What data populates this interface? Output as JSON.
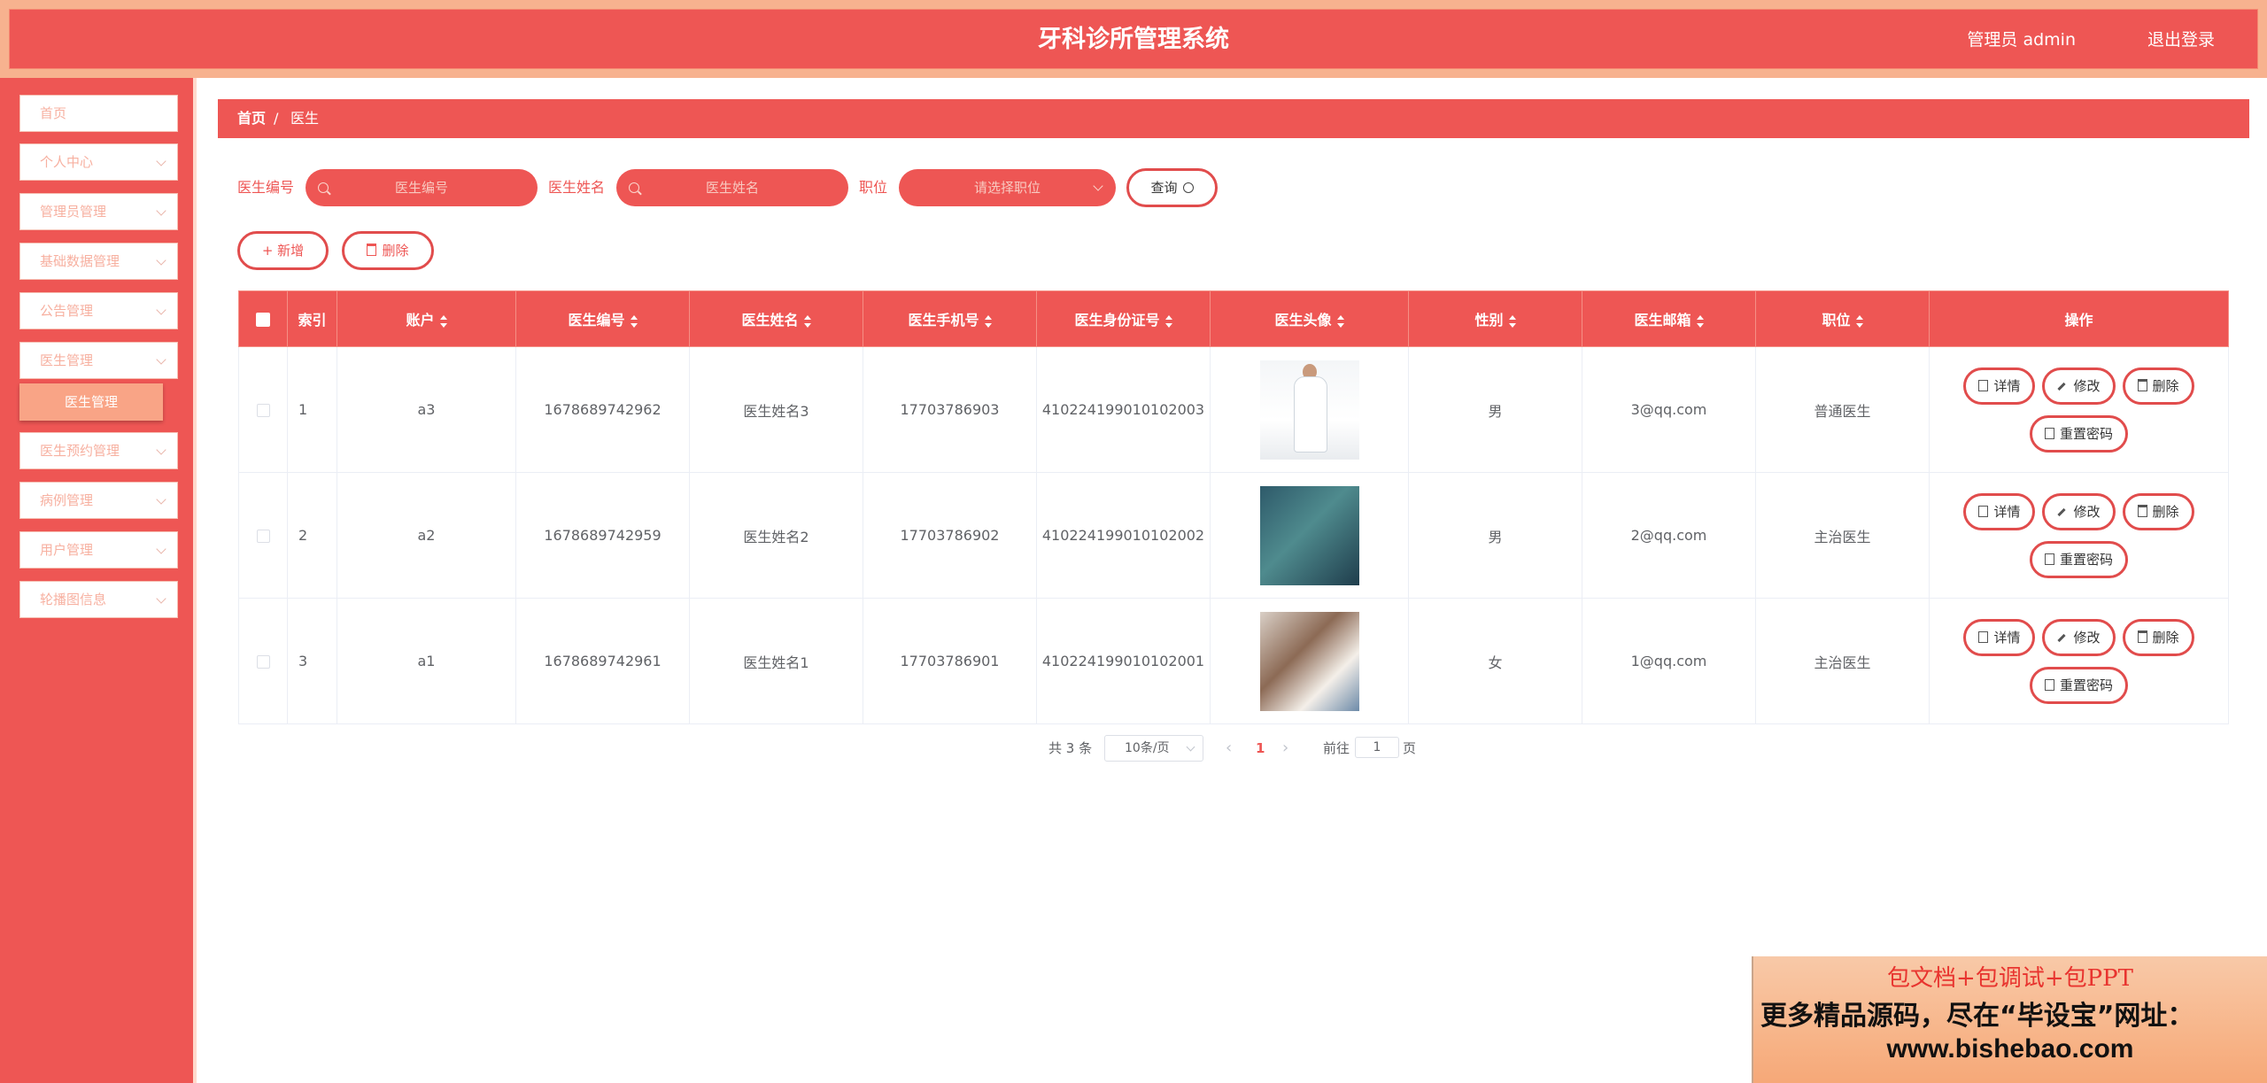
{
  "header": {
    "title": "牙科诊所管理系统",
    "user": "管理员 admin",
    "logout": "退出登录"
  },
  "sidebar": {
    "items": [
      {
        "label": "首页"
      },
      {
        "label": "个人中心"
      },
      {
        "label": "管理员管理"
      },
      {
        "label": "基础数据管理"
      },
      {
        "label": "公告管理"
      },
      {
        "label": "医生管理"
      },
      {
        "label": "医生预约管理"
      },
      {
        "label": "病例管理"
      },
      {
        "label": "用户管理"
      },
      {
        "label": "轮播图信息"
      }
    ],
    "active_sub": "医生管理"
  },
  "breadcrumb": {
    "home": "首页",
    "sep": "/",
    "current": "医生"
  },
  "search": {
    "code_label": "医生编号",
    "code_placeholder": "医生编号",
    "name_label": "医生姓名",
    "name_placeholder": "医生姓名",
    "position_label": "职位",
    "position_placeholder": "请选择职位",
    "query": "查询"
  },
  "actions": {
    "add": "+ 新增",
    "delete": "删除"
  },
  "table": {
    "headers": [
      "索引",
      "账户",
      "医生编号",
      "医生姓名",
      "医生手机号",
      "医生身份证号",
      "医生头像",
      "性别",
      "医生邮箱",
      "职位",
      "操作"
    ],
    "rows": [
      {
        "index": "1",
        "account": "a3",
        "code": "1678689742962",
        "name": "医生姓名3",
        "phone": "17703786903",
        "idcard": "410224199010102003",
        "avatar": "doctor-in-white-coat",
        "gender": "男",
        "email": "3@qq.com",
        "position": "普通医生"
      },
      {
        "index": "2",
        "account": "a2",
        "code": "1678689742959",
        "name": "医生姓名2",
        "phone": "17703786902",
        "idcard": "410224199010102002",
        "avatar": "surgical-team",
        "gender": "男",
        "email": "2@qq.com",
        "position": "主治医生"
      },
      {
        "index": "3",
        "account": "a1",
        "code": "1678689742961",
        "name": "医生姓名1",
        "phone": "17703786901",
        "idcard": "410224199010102001",
        "avatar": "doctor-with-xray",
        "gender": "女",
        "email": "1@qq.com",
        "position": "主治医生"
      }
    ],
    "ops": {
      "detail": "详情",
      "edit": "修改",
      "delete": "删除",
      "reset": "重置密码"
    }
  },
  "pagination": {
    "total": "共 3 条",
    "page_size": "10条/页",
    "current": "1",
    "goto": "前往",
    "goto_value": "1",
    "page_unit": "页"
  },
  "watermark": {
    "line1": "包文档+包调试+包PPT",
    "line2": "更多精品源码，尽在“毕设宝”网址：",
    "line3": "www.bishebao.com"
  },
  "colors": {
    "primary": "#ee5654",
    "header_frame": "#f7b28f",
    "submenu_active": "#f9a486"
  }
}
